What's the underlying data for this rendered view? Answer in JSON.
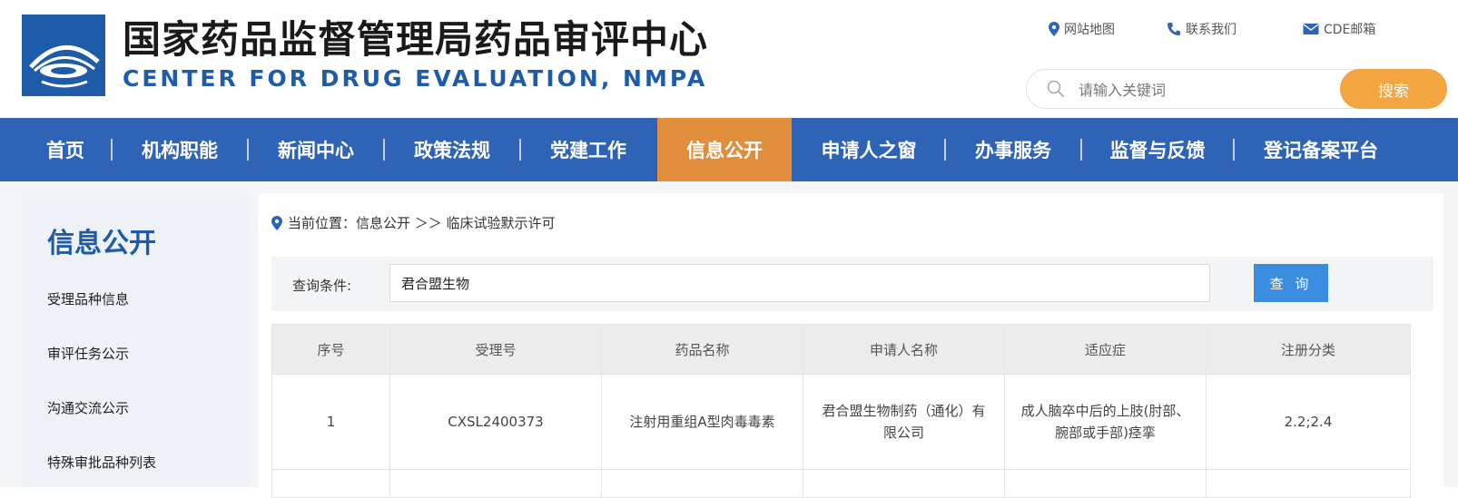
{
  "header": {
    "title_cn": "国家药品监督管理局药品审评中心",
    "title_en": "CENTER FOR DRUG EVALUATION, NMPA",
    "links": [
      {
        "label": "网站地图",
        "icon": "location-pin-icon"
      },
      {
        "label": "联系我们",
        "icon": "phone-icon"
      },
      {
        "label": "CDE邮箱",
        "icon": "mail-icon"
      }
    ],
    "search": {
      "placeholder": "请输入关键词",
      "button_label": "搜索"
    }
  },
  "nav": {
    "items": [
      "首页",
      "机构职能",
      "新闻中心",
      "政策法规",
      "党建工作",
      "信息公开",
      "申请人之窗",
      "办事服务",
      "监督与反馈",
      "登记备案平台"
    ],
    "active_index": 5
  },
  "sidebar": {
    "title": "信息公开",
    "items": [
      "受理品种信息",
      "审评任务公示",
      "沟通交流公示",
      "特殊审批品种列表"
    ]
  },
  "breadcrumb": {
    "prefix": "当前位置：",
    "path": "信息公开 ＞＞ 临床试验默示许可"
  },
  "query": {
    "label": "查询条件:",
    "value": "君合盟生物",
    "button_label": "查 询"
  },
  "table": {
    "headers": [
      "序号",
      "受理号",
      "药品名称",
      "申请人名称",
      "适应症",
      "注册分类"
    ],
    "rows": [
      [
        "1",
        "CXSL2400373",
        "注射用重组A型肉毒毒素",
        "君合盟生物制药（通化）有限公司",
        "成人脑卒中后的上肢(肘部、腕部或手部)痉挛",
        "2.2;2.4"
      ]
    ]
  },
  "colors": {
    "brand_blue": "#2f63b5",
    "nav_active": "#e08d3c",
    "search_button": "#f2a541",
    "query_button": "#3b8de0"
  }
}
